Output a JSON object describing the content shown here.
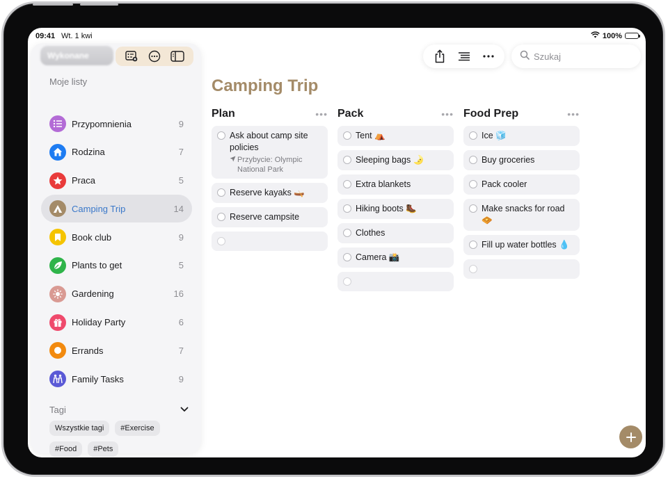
{
  "status_bar": {
    "time": "09:41",
    "date": "Wt. 1 kwi",
    "battery": "100%"
  },
  "sidebar": {
    "toolbar": {
      "ghost_label": "Wykonane"
    },
    "section_title": "Moje listy",
    "lists": [
      {
        "label": "Przypomnienia",
        "count": "9",
        "color": "#b36bd6",
        "icon": "list-bullet-icon"
      },
      {
        "label": "Rodzina",
        "count": "7",
        "color": "#1e7cf2",
        "icon": "house-icon"
      },
      {
        "label": "Praca",
        "count": "5",
        "color": "#e93b3b",
        "icon": "star-icon"
      },
      {
        "label": "Camping Trip",
        "count": "14",
        "color": "#a48b68",
        "icon": "tent-icon",
        "selected": true
      },
      {
        "label": "Book club",
        "count": "9",
        "color": "#f5c400",
        "icon": "bookmark-icon"
      },
      {
        "label": "Plants to get",
        "count": "5",
        "color": "#2fb44a",
        "icon": "leaf-icon"
      },
      {
        "label": "Gardening",
        "count": "16",
        "color": "#d99a93",
        "icon": "sun-icon"
      },
      {
        "label": "Holiday Party",
        "count": "6",
        "color": "#ef4a6c",
        "icon": "gift-icon"
      },
      {
        "label": "Errands",
        "count": "7",
        "color": "#f28a0f",
        "icon": "circle-icon"
      },
      {
        "label": "Family Tasks",
        "count": "9",
        "color": "#5a59d6",
        "icon": "people-icon"
      }
    ],
    "tags_title": "Tagi",
    "tags": [
      "Wszystkie tagi",
      "#Exercise",
      "#Food",
      "#Pets"
    ]
  },
  "search": {
    "placeholder": "Szukaj"
  },
  "main": {
    "title": "Camping Trip",
    "accent": "#a48b68",
    "columns": [
      {
        "title": "Plan",
        "items": [
          {
            "text": "Ask about camp site policies",
            "sub": "Przybycie: Olympic National Park"
          },
          {
            "text": "Reserve kayaks 🛶"
          },
          {
            "text": "Reserve campsite"
          }
        ]
      },
      {
        "title": "Pack",
        "items": [
          {
            "text": "Tent ⛺"
          },
          {
            "text": "Sleeping bags 🌛"
          },
          {
            "text": "Extra blankets"
          },
          {
            "text": "Hiking boots 🥾"
          },
          {
            "text": "Clothes"
          },
          {
            "text": "Camera 📸"
          }
        ]
      },
      {
        "title": "Food Prep",
        "items": [
          {
            "text": "Ice 🧊"
          },
          {
            "text": "Buy groceries"
          },
          {
            "text": "Pack cooler"
          },
          {
            "text": "Make snacks for road 🧇"
          },
          {
            "text": "Fill up water bottles 💧"
          }
        ]
      }
    ]
  }
}
